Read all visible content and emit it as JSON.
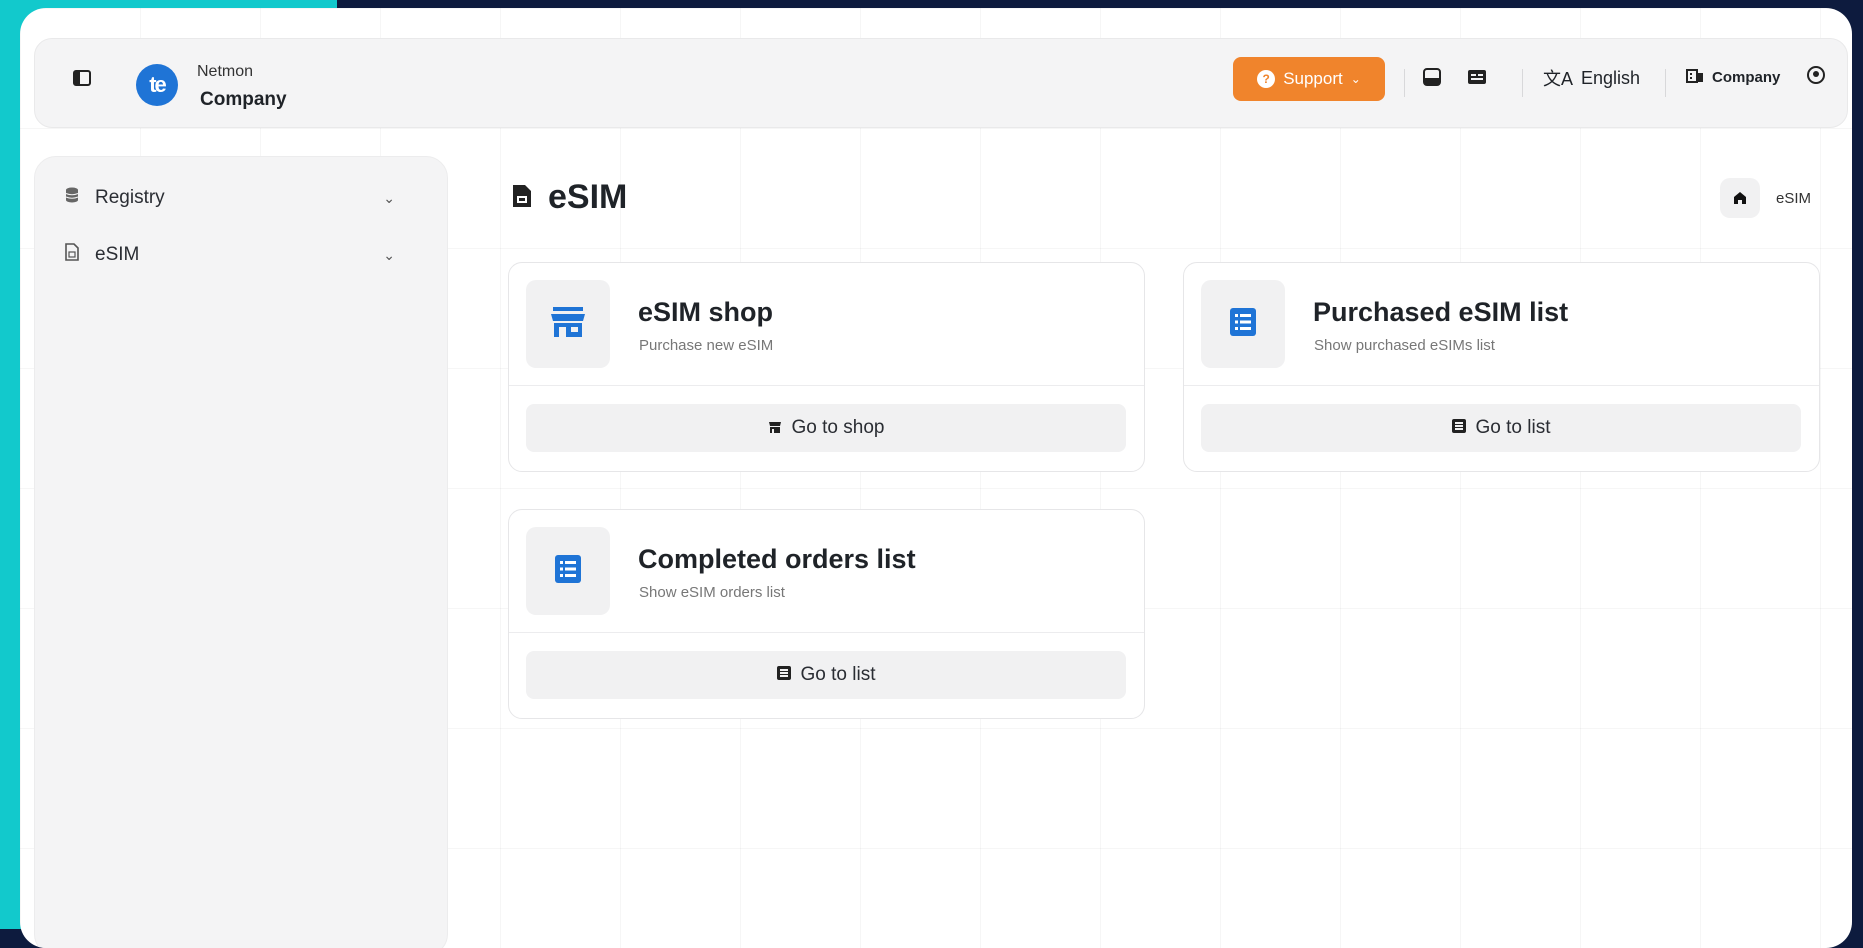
{
  "header": {
    "brand_top": "Netmon",
    "brand_name": "Company",
    "support_label": "Support",
    "language_label": "English",
    "company_label": "Company"
  },
  "sidebar": {
    "items": [
      {
        "label": "Registry",
        "icon": "database-icon"
      },
      {
        "label": "eSIM",
        "icon": "sim-card-icon"
      }
    ]
  },
  "page": {
    "title": "eSIM",
    "breadcrumb_current": "eSIM"
  },
  "cards": [
    {
      "title": "eSIM shop",
      "subtitle": "Purchase new eSIM",
      "button": "Go to shop",
      "icon": "store-icon"
    },
    {
      "title": "Purchased eSIM list",
      "subtitle": "Show purchased eSIMs list",
      "button": "Go to list",
      "icon": "list-icon"
    },
    {
      "title": "Completed orders list",
      "subtitle": "Show eSIM orders list",
      "button": "Go to list",
      "icon": "list-icon"
    }
  ],
  "colors": {
    "accent_blue": "#1f74d6",
    "support_orange": "#f0842c",
    "teal_band": "#12c9cc",
    "background_navy": "#0d1b3e"
  }
}
